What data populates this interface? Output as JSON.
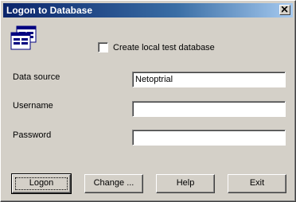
{
  "window": {
    "title": "Logon to Database",
    "icon": "database-forms-icon"
  },
  "options": {
    "create_local_label": "Create local test database",
    "create_local_checked": false
  },
  "fields": {
    "data_source": {
      "label": "Data source",
      "value": "Netoptrial"
    },
    "username": {
      "label": "Username",
      "value": ""
    },
    "password": {
      "label": "Password",
      "value": ""
    }
  },
  "buttons": {
    "logon": "Logon",
    "change": "Change ...",
    "help": "Help",
    "exit": "Exit"
  },
  "colors": {
    "face": "#d4d0c8",
    "title_start": "#0a246a",
    "title_end": "#a6caf0"
  }
}
